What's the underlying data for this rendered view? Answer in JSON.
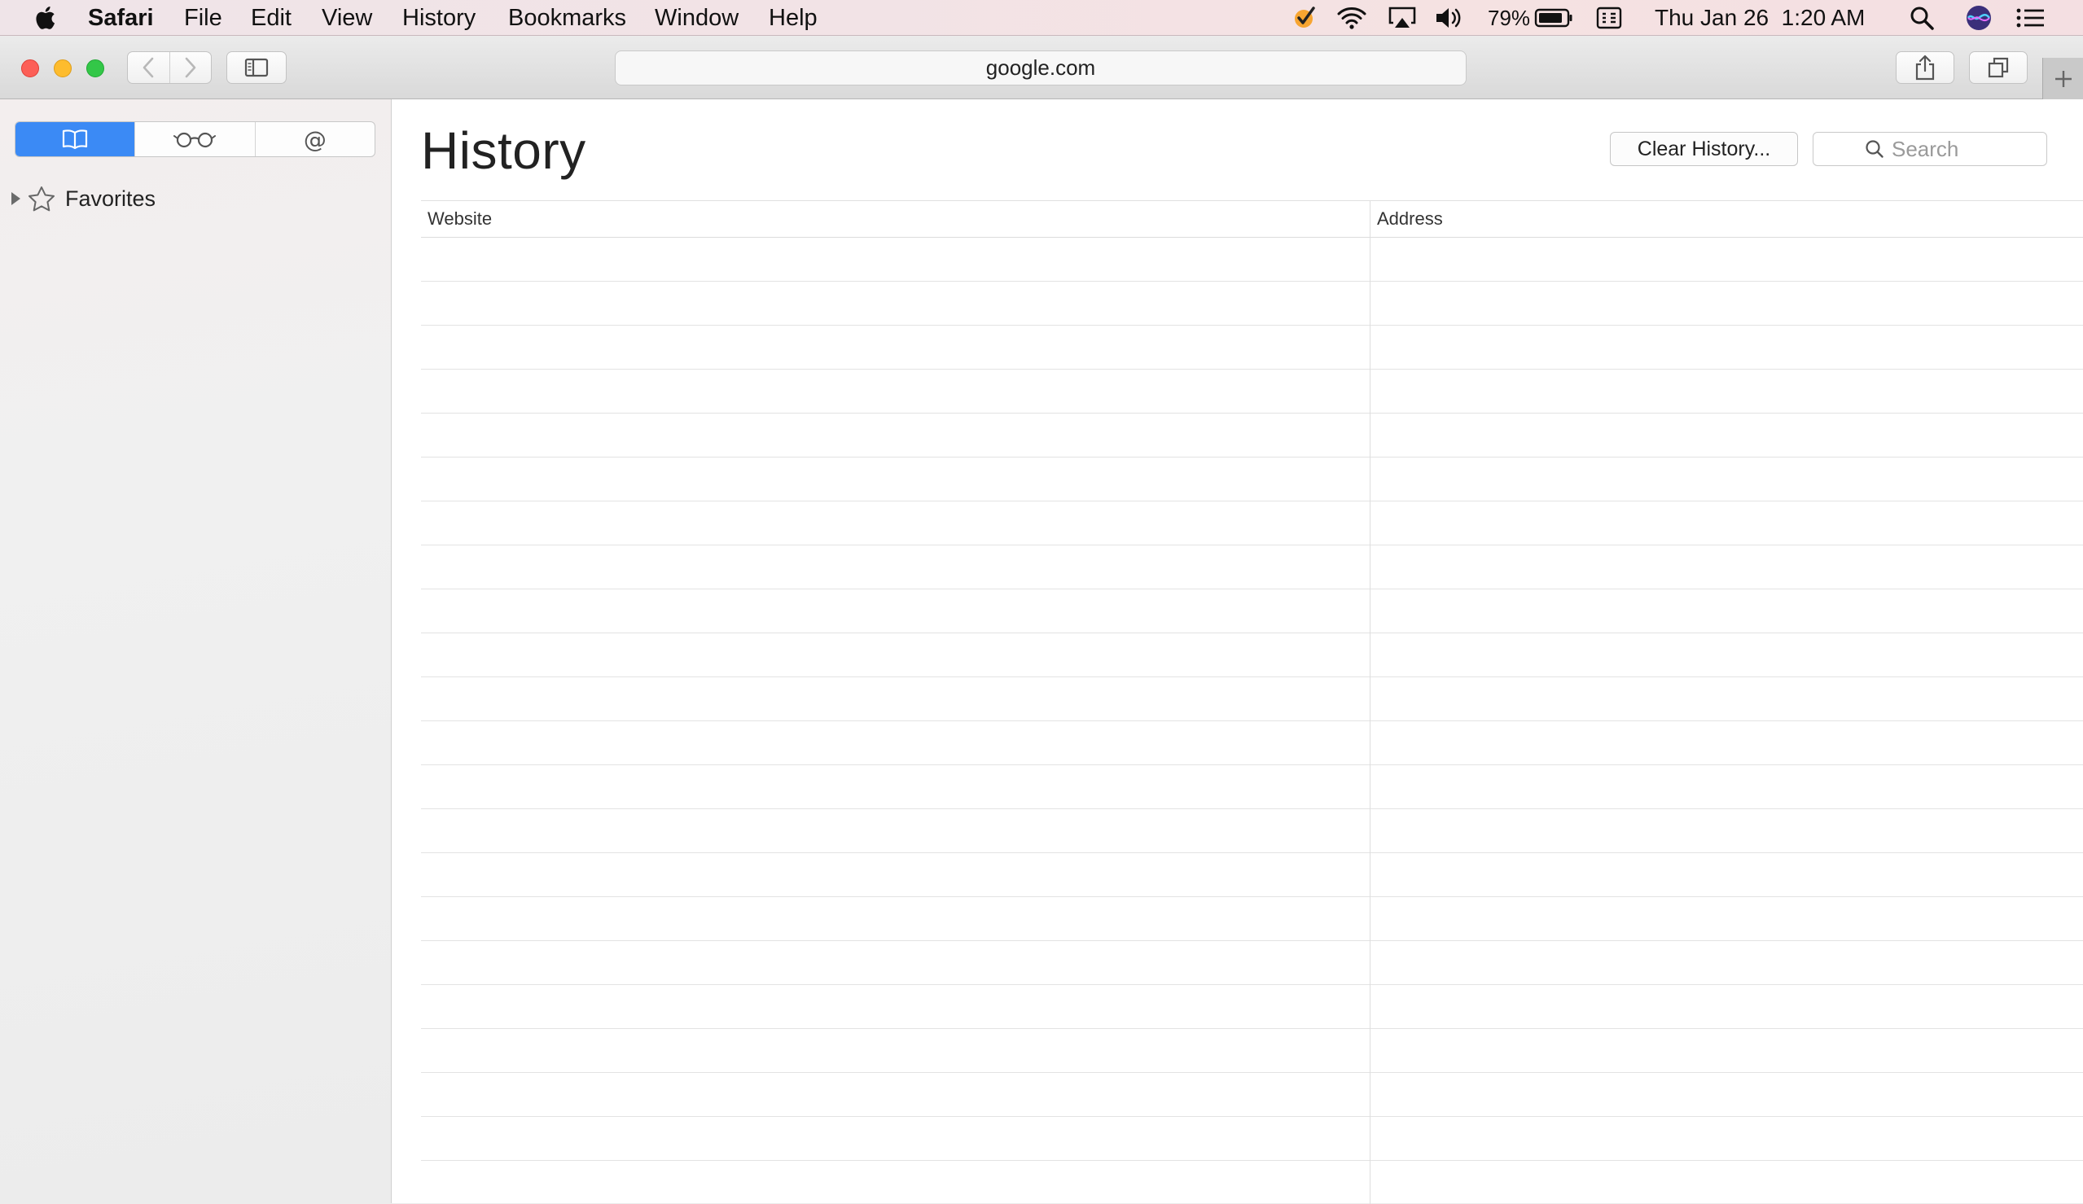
{
  "menubar": {
    "app_name": "Safari",
    "items": [
      "File",
      "Edit",
      "View",
      "History",
      "Bookmarks",
      "Window",
      "Help"
    ],
    "battery_percent": "79%",
    "clock": "Thu Jan 26  1:20 AM"
  },
  "toolbar": {
    "address": "google.com"
  },
  "sidebar": {
    "tabs": [
      "bookmarks-icon",
      "reading-list-icon",
      "shared-links-icon"
    ],
    "active_tab": "bookmarks-icon",
    "favorites_label": "Favorites"
  },
  "history": {
    "title": "History",
    "clear_button_label": "Clear History...",
    "search_placeholder": "Search",
    "columns": [
      "Website",
      "Address"
    ],
    "rows": []
  },
  "colors": {
    "accent": "#3b8af5",
    "close": "#fc5f57",
    "minimize": "#fdbc2e",
    "zoom": "#33c748"
  }
}
